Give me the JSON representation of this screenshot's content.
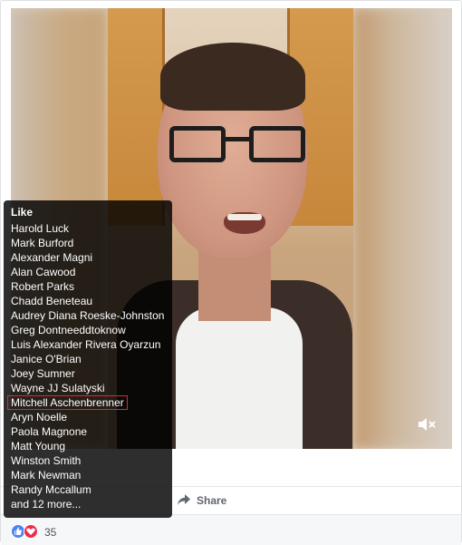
{
  "video": {
    "mute_icon": "speaker-muted-icon"
  },
  "likes_tooltip": {
    "title": "Like",
    "names": [
      "Harold Luck",
      "Mark Burford",
      "Alexander Magni",
      "Alan Cawood",
      "Robert Parks",
      "Chadd Beneteau",
      "Audrey Diana Roeske-Johnston",
      "Greg Dontneeddtoknow",
      "Luis Alexander Rivera Oyarzun",
      "Janice O'Brian",
      "Joey Sumner",
      "Wayne JJ Sulatyski",
      "Mitchell Aschenbrenner",
      "Aryn Noelle",
      "Paola Magnone",
      "Matt Young",
      "Winston Smith",
      "Mark Newman",
      "Randy Mccallum"
    ],
    "highlighted_name": "Mitchell Aschenbrenner",
    "more": "and 12 more...",
    "highlight_color": "#e0262f"
  },
  "actions": {
    "share_label": "Share",
    "share_icon": "share-arrow-icon"
  },
  "reactions": {
    "like_icon": "thumbs-up-icon",
    "love_icon": "heart-icon",
    "count": "35",
    "like_color": "#4d84f2",
    "love_color": "#f0284a"
  }
}
